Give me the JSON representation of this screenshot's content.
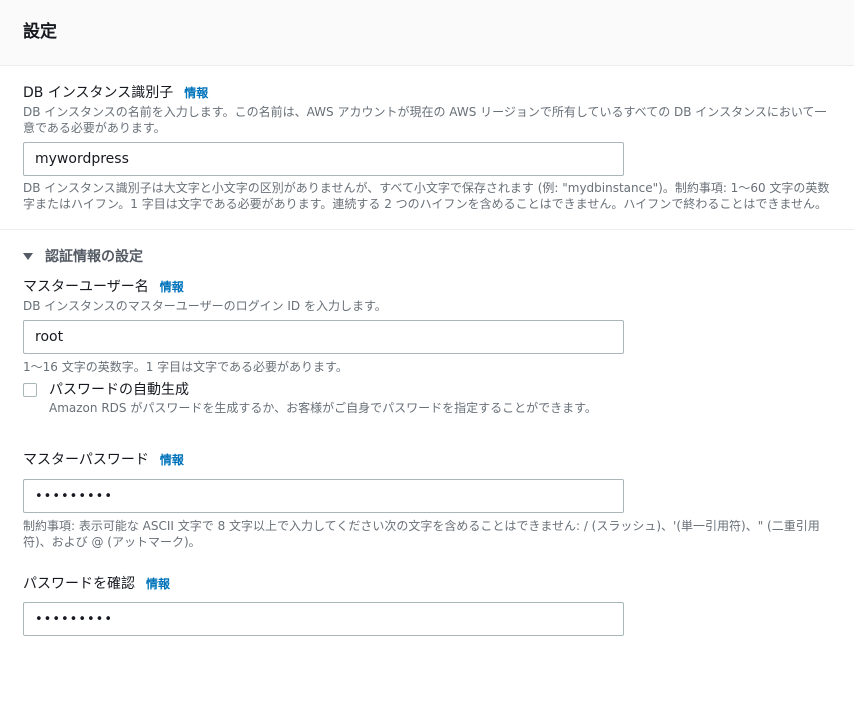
{
  "header": {
    "title": "設定"
  },
  "info_label": "情報",
  "db_identifier": {
    "label": "DB インスタンス識別子",
    "description": "DB インスタンスの名前を入力します。この名前は、AWS アカウントが現在の AWS リージョンで所有しているすべての DB インスタンスにおいて一意である必要があります。",
    "value": "mywordpress",
    "constraint": "DB インスタンス識別子は大文字と小文字の区別がありませんが、すべて小文字で保存されます (例: \"mydbinstance\")。制約事項: 1〜60 文字の英数字またはハイフン。1 字目は文字である必要があります。連続する 2 つのハイフンを含めることはできません。ハイフンで終わることはできません。"
  },
  "credentials": {
    "title": "認証情報の設定",
    "master_username": {
      "label": "マスターユーザー名",
      "description": "DB インスタンスのマスターユーザーのログイン ID を入力します。",
      "value": "root",
      "constraint": "1〜16 文字の英数字。1 字目は文字である必要があります。"
    },
    "auto_generate": {
      "label": "パスワードの自動生成",
      "description": "Amazon RDS がパスワードを生成するか、お客様がご自身でパスワードを指定することができます。",
      "checked": false
    },
    "master_password": {
      "label": "マスターパスワード",
      "value": "•••••••••",
      "constraint": "制約事項: 表示可能な ASCII 文字で 8 文字以上で入力してください次の文字を含めることはできません: / (スラッシュ)、'(単一引用符)、\" (二重引用符)、および @ (アットマーク)。"
    },
    "confirm_password": {
      "label": "パスワードを確認",
      "value": "•••••••••"
    }
  }
}
